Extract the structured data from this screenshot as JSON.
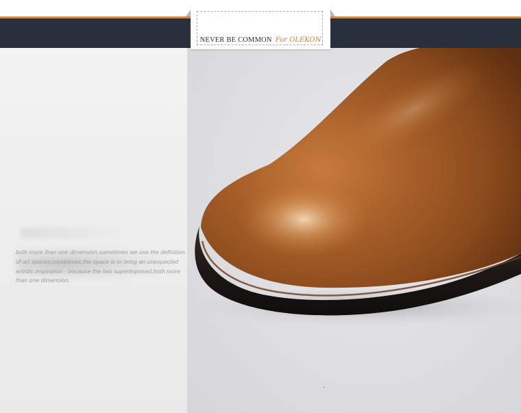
{
  "banner": {
    "tagline": "NEVER BE COMMON",
    "brand": "For OLEKON"
  },
  "description": {
    "text": "both more than one dimension.sometimes we use the definition of art spaces;sometimes,the space is to bring an unexpected artistic inspiration - because the two superimposed,both more than one dimension."
  },
  "colors": {
    "accent": "#c98a4a",
    "band": "#28303e",
    "leather": "#9b5520"
  },
  "image": {
    "subject": "brown-leather-shoe-toe"
  }
}
